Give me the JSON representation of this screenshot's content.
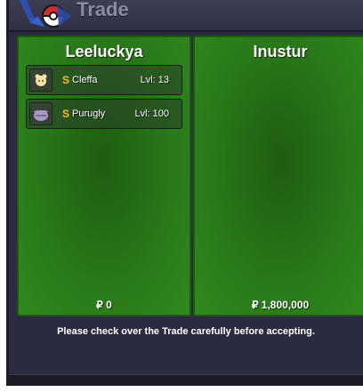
{
  "window": {
    "title": "Trade"
  },
  "left_panel": {
    "trainer": "Leeluckya",
    "money": "₽ 0",
    "slots": [
      {
        "coin": "S",
        "name": "Cleffa",
        "level": "Lvl: 13",
        "icon": "cleffa-sprite-icon"
      },
      {
        "coin": "S",
        "name": "Purugly",
        "level": "Lvl: 100",
        "icon": "purugly-sprite-icon"
      }
    ]
  },
  "right_panel": {
    "trainer": "Inustur",
    "money": "₽ 1,800,000",
    "slots": []
  },
  "notice": "Please check over the Trade carefully before accepting.",
  "colors": {
    "panel_green": "#2a7a1a",
    "coin_gold": "#e8c230",
    "window_bg": "#2a2b3e"
  }
}
